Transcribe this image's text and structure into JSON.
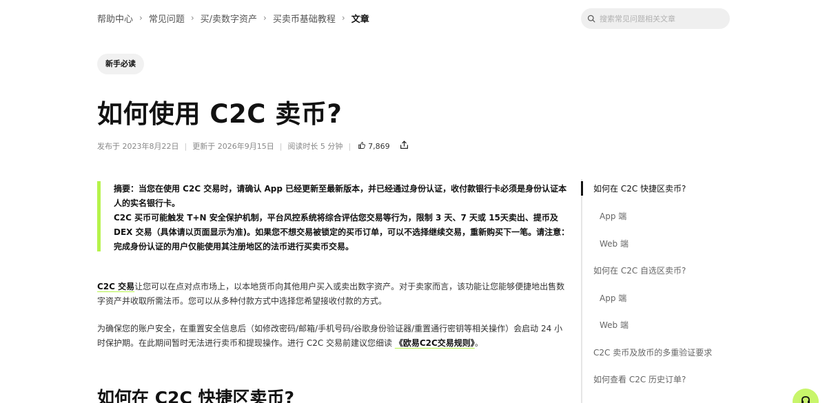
{
  "breadcrumb": {
    "items": [
      "帮助中心",
      "常见问题",
      "买/卖数字资产",
      "买卖币基础教程",
      "文章"
    ]
  },
  "search": {
    "placeholder": "搜索常见问题相关文章"
  },
  "article": {
    "tag": "新手必读",
    "title": "如何使用 C2C 卖币?",
    "meta": {
      "published": "发布于 2023年8月22日",
      "updated": "更新于 2026年9月15日",
      "read_time": "阅读时长 5 分钟",
      "likes": "7,869"
    },
    "summary": {
      "line1": "摘要：当您在使用 C2C 交易时，请确认 App 已经更新至最新版本，并已经通过身份认证，收付款银行卡必须是身份认证本人的实名银行卡。",
      "line2": "C2C 买币可能触发 T+N 安全保护机制，平台风控系统将综合评估您交易等行为，限制 3 天、7 天或 15天卖出、提币及 DEX 交易（具体请以页面显示为准)。如果您不想交易被锁定的买币订单，可以不选择继续交易，重新购买下一笔。请注意：完成身份认证的用户仅能使用其注册地区的法币进行买卖币交易。"
    },
    "para1": {
      "link": "C2C 交易",
      "text": "让您可以在点对点市场上，以本地货币向其他用户买入或卖出数字资产。对于卖家而言，该功能让您能够便捷地出售数字资产并收取所需法币。您可以从多种付款方式中选择您希望接收付款的方式。"
    },
    "para2": {
      "text": "为确保您的账户安全，在重置安全信息后（如修改密码/邮箱/手机号码/谷歌身份验证器/重置通行密钥等相关操作）会启动 24 小时保护期。在此期间暂时无法进行卖币和提现操作。进行 C2C 交易前建议您细读 ",
      "link": "《欧易C2C交易规则》",
      "suffix": "。"
    },
    "section_heading": "如何在 C2C 快捷区卖币?"
  },
  "toc": {
    "items": [
      "如何在 C2C 快捷区卖币?",
      "App 端",
      "Web 端",
      "如何在 C2C 自选区卖币?",
      "App 端",
      "Web 端",
      "C2C 卖币及放币的多重验证要求",
      "如何查看 C2C 历史订单?"
    ]
  },
  "colors": {
    "accent": "#b5f34a",
    "text": "#121212",
    "muted": "#888888"
  }
}
